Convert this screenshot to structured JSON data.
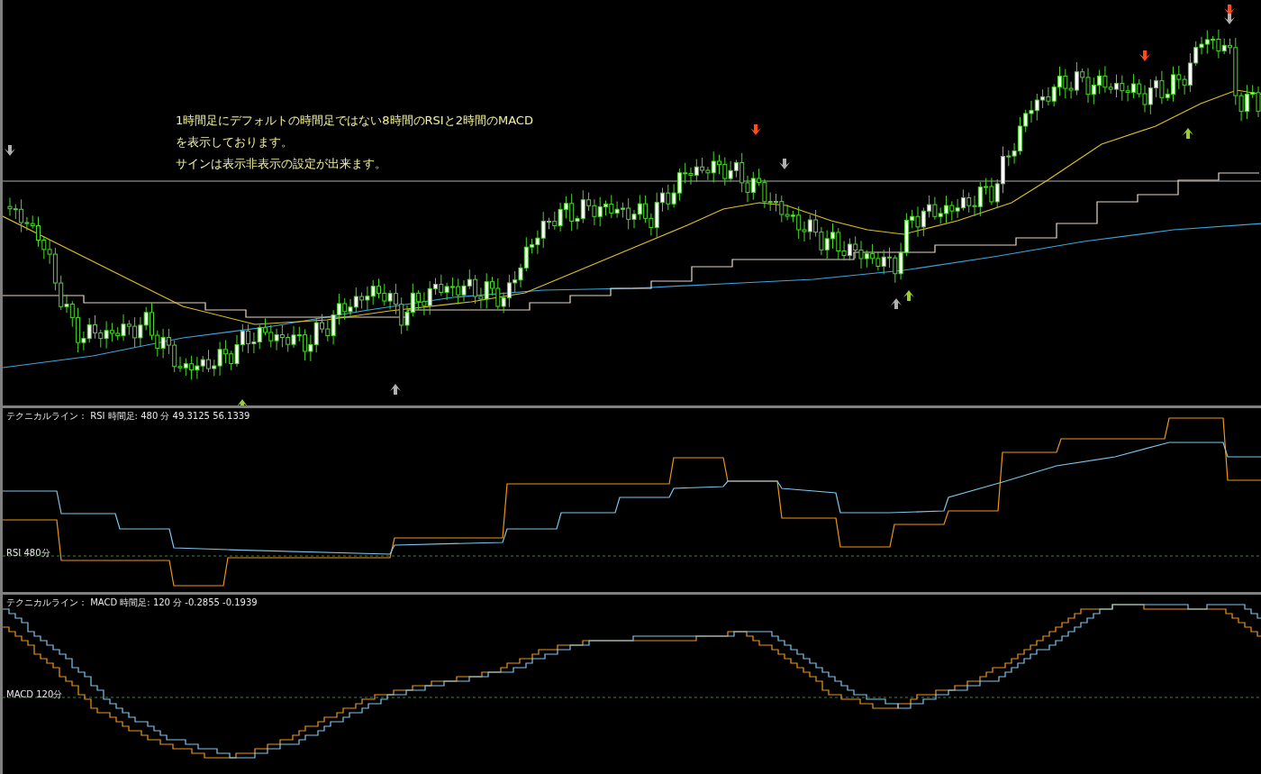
{
  "price_pane": {
    "annotation": [
      "1時間足にデフォルトの時間足ではない8時間のRSIと2時間のMACD",
      "を表示しております。",
      "サインは表示非表示の設定が出来ます。"
    ]
  },
  "rsi_pane": {
    "header": "テクニカルライン： RSI  時間足: 480 分 49.3125 56.1339",
    "level_label": "RSI  480分"
  },
  "macd_pane": {
    "header": "テクニカルライン： MACD  時間足: 120 分 -0.2855 -0.1939",
    "level_label": "MACD  120分"
  }
}
